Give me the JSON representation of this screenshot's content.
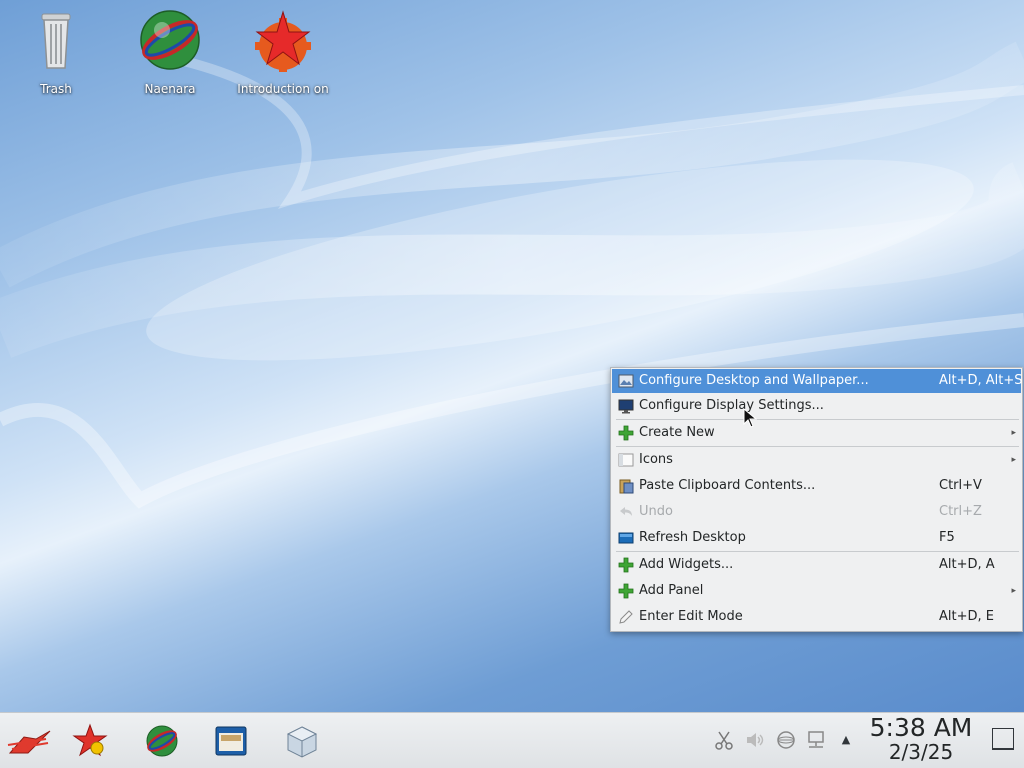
{
  "desktop": {
    "icons": [
      {
        "label": "Trash",
        "icon": "trash-icon"
      },
      {
        "label": "Naenara",
        "icon": "globe-icon"
      },
      {
        "label": "Introduction on",
        "icon": "star-gear-icon"
      }
    ]
  },
  "context_menu": {
    "items": [
      {
        "label": "Configure Desktop and Wallpaper...",
        "shortcut": "Alt+D, Alt+S",
        "icon": "wallpaper-icon"
      },
      {
        "label": "Configure Display Settings...",
        "shortcut": "",
        "icon": "monitor-icon"
      },
      {
        "label": "Create New",
        "shortcut": "",
        "icon": "plus-icon",
        "submenu": true
      },
      {
        "label": "Icons",
        "shortcut": "",
        "icon": "icons-view-icon",
        "submenu": true
      },
      {
        "label": "Paste Clipboard Contents...",
        "shortcut": "Ctrl+V",
        "icon": "paste-icon"
      },
      {
        "label": "Undo",
        "shortcut": "Ctrl+Z",
        "icon": "undo-icon",
        "disabled": true
      },
      {
        "label": "Refresh Desktop",
        "shortcut": "F5",
        "icon": "refresh-icon"
      },
      {
        "label": "Add Widgets...",
        "shortcut": "Alt+D, A",
        "icon": "plus-icon"
      },
      {
        "label": "Add Panel",
        "shortcut": "",
        "icon": "plus-icon",
        "submenu": true
      },
      {
        "label": "Enter Edit Mode",
        "shortcut": "Alt+D, E",
        "icon": "edit-icon"
      }
    ],
    "submenu_arrow": "▸"
  },
  "taskbar": {
    "launchers": [
      "app-launcher-star-icon",
      "star-badge-icon",
      "globe-icon",
      "file-manager-icon",
      "package-box-icon"
    ],
    "tray": [
      "clipboard-scissors-icon",
      "volume-icon",
      "network-globe-icon",
      "network-wired-icon",
      "expand-tray-icon"
    ],
    "tray_expand_glyph": "▲",
    "clock": {
      "time": "5:38 AM",
      "date": "2/3/25"
    }
  },
  "colors": {
    "highlight": "#4f90d8",
    "menu_bg": "#eff0f1",
    "taskbar_bg": "#e6e9ec"
  }
}
